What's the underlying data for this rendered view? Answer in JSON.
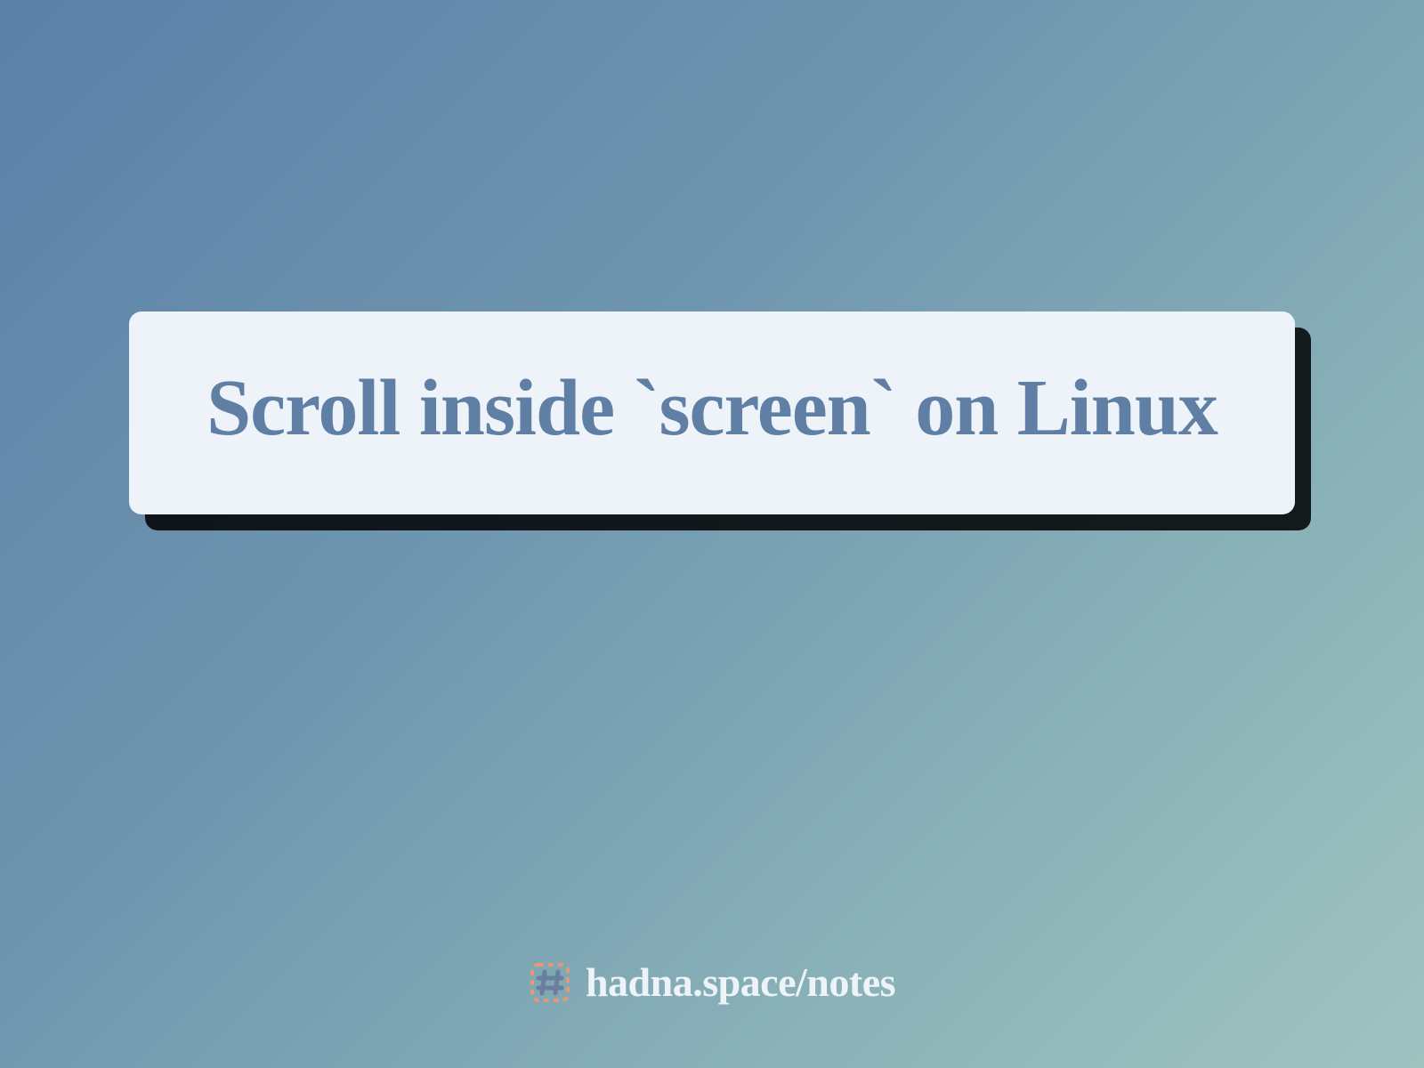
{
  "card": {
    "title": "Scroll inside `screen` on Linux"
  },
  "footer": {
    "site": "hadna.space/notes"
  },
  "colors": {
    "title_text": "#5f7fa5",
    "card_bg": "#eef3fa",
    "footer_text": "#eef3fa",
    "icon_border": "#e09a7a",
    "icon_fill": "#6a7fa0"
  }
}
